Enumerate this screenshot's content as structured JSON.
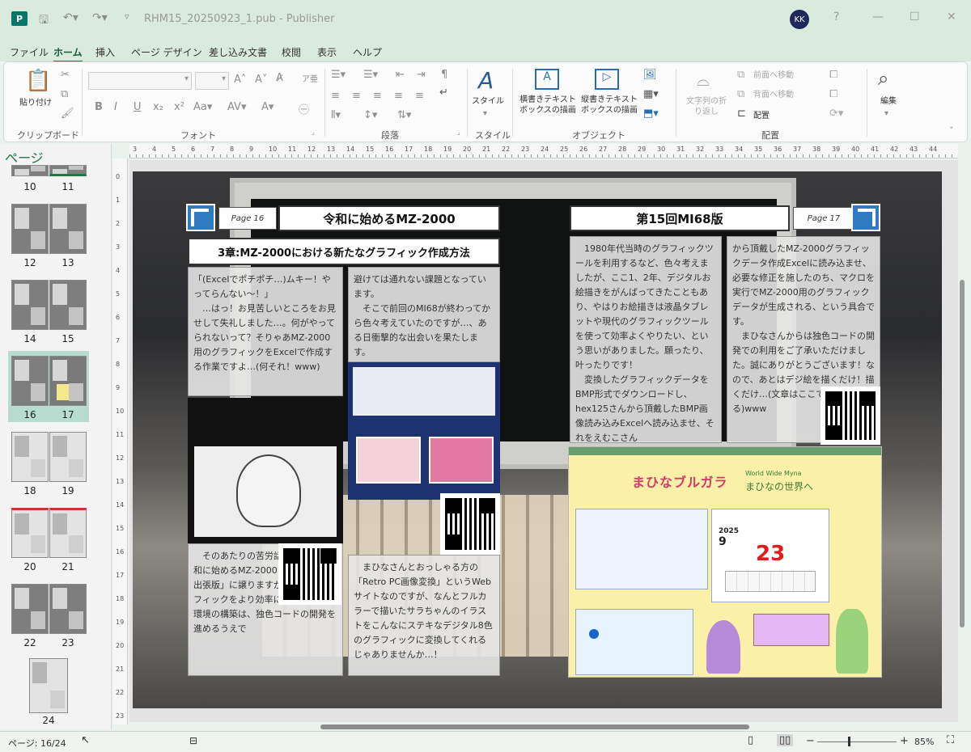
{
  "window": {
    "title": "RHM15_20250923_1.pub - Publisher",
    "avatar_initials": "KK",
    "help": "?",
    "min": "—",
    "max": "☐",
    "close": "✕"
  },
  "menu": {
    "tabs": [
      "ファイル",
      "ホーム",
      "挿入",
      "ページ デザイン",
      "差し込み文書",
      "校閲",
      "表示",
      "ヘルプ"
    ],
    "active": "ホーム"
  },
  "ribbon": {
    "clipboard": {
      "paste": "貼り付け",
      "label": "クリップボード"
    },
    "font": {
      "label": "フォント"
    },
    "paragraph": {
      "label": "段落"
    },
    "styles": {
      "style": "スタイル",
      "label": "スタイル"
    },
    "objects": {
      "horizontal_textbox": "横書きテキスト\nボックスの描画",
      "vertical_textbox": "縦書きテキスト\nボックスの描画",
      "label": "オブジェクト"
    },
    "arrange": {
      "wrap": "文字列の折\nり返し",
      "forward": "前面へ移動",
      "backward": "背面へ移動",
      "align": "配置",
      "label": "配置"
    },
    "edit": {
      "label": "編集"
    }
  },
  "pages_panel": {
    "title": "ページ",
    "items": [
      {
        "left": "10",
        "right": "11"
      },
      {
        "left": "12",
        "right": "13"
      },
      {
        "left": "14",
        "right": "15"
      },
      {
        "left": "16",
        "right": "17",
        "selected": true
      },
      {
        "left": "18",
        "right": "19"
      },
      {
        "left": "20",
        "right": "21"
      },
      {
        "left": "22",
        "right": "23"
      },
      {
        "single": "24"
      }
    ]
  },
  "ruler": {
    "top_numbers": [
      "3",
      "4",
      "5",
      "6",
      "7",
      "8",
      "9",
      "10",
      "11",
      "12",
      "13",
      "14",
      "15",
      "16",
      "17",
      "18",
      "19",
      "20",
      "21",
      "22",
      "23",
      "24",
      "25",
      "26",
      "27",
      "28",
      "29",
      "30",
      "31",
      "32",
      "33",
      "34",
      "35",
      "36",
      "37",
      "38",
      "39",
      "40",
      "41",
      "42",
      "43",
      "44"
    ],
    "left_numbers": [
      "0",
      "1",
      "2",
      "3",
      "4",
      "5",
      "6",
      "7",
      "8",
      "9",
      "10",
      "11",
      "12",
      "13",
      "14",
      "15",
      "16",
      "17",
      "18",
      "19",
      "20",
      "21",
      "22",
      "23"
    ]
  },
  "publication": {
    "left": {
      "page_no": "Page 16",
      "title": "令和に始めるMZ-2000",
      "chapter": "3章:MZ-2000における新たなグラフィック作成方法",
      "col1_top": "「(Excelでポチポチ…)ムキー！やってらんない〜！」\n　…はっ！お見苦しいところをお見せして失礼しました…。何がやってられないって？そりゃあMZ-2000用のグラフィックをExcelで作成する作業ですよ…(何それ！www)",
      "col1_bottom": "　そのあたりの苦労話は、既刊「令和に始めるMZ-2000 第14回MI68出張版」に譲りますが、やはりグラフィックをより効率に作成する作業環境の構築は、独色コードの開発を進めるうえで",
      "col2_top": "避けては通れない課題となっています。\n　そこで前回のMI68が終わってから色々考えていたのですが…、ある日衝撃的な出会いを果たします。",
      "col2_bottom": "　まひなさんとおっしゃる方の「Retro PC画像変換」というWebサイトなのですが、なんとフルカラーで描いたサラちゃんのイラストをこんなにステキなデジタル8色のグラフィックに変換してくれるじゃありませんか…！"
    },
    "right": {
      "page_no": "Page 17",
      "title": "第15回MI68版",
      "col1": "　1980年代当時のグラフィックツールを利用するなど、色々考えましたが、ここ1、2年、デジタルお絵描きをがんばってきたこともあり、やはりお絵描きは液晶タブレットや現代のグラフィックツールを使って効率よくやりたい、という思いがありました。願ったり、叶ったりです！\n　変換したグラフィックデータをBMP形式でダウンロードし、hex125さんから頂戴したBMP画像読み込みExcelへ読み込ませ、それをえむこさん",
      "col2": "から頂戴したMZ-2000グラフィックデータ作成Excelに読み込ませ、必要な修正を施したのち、マクロを実行でMZ-2000用のグラフィックデータが生成される、という具合です。\n　まひなさんからは独色コードの開発での利用をご了承いただけました。誠にありがとうございます！なので、あとはデジ絵を描くだけ！描くだけ…(文章はここで途絶えている)www",
      "web_title": "まひなの世界へ",
      "web_sub": "World Wide Myna",
      "calendar_year": "2025",
      "calendar_month": "9",
      "calendar_day": "23",
      "logo_text": "まひなブルガラ"
    }
  },
  "status": {
    "page": "ページ: 16/24",
    "zoom": "85%",
    "minus": "−",
    "plus": "+"
  }
}
